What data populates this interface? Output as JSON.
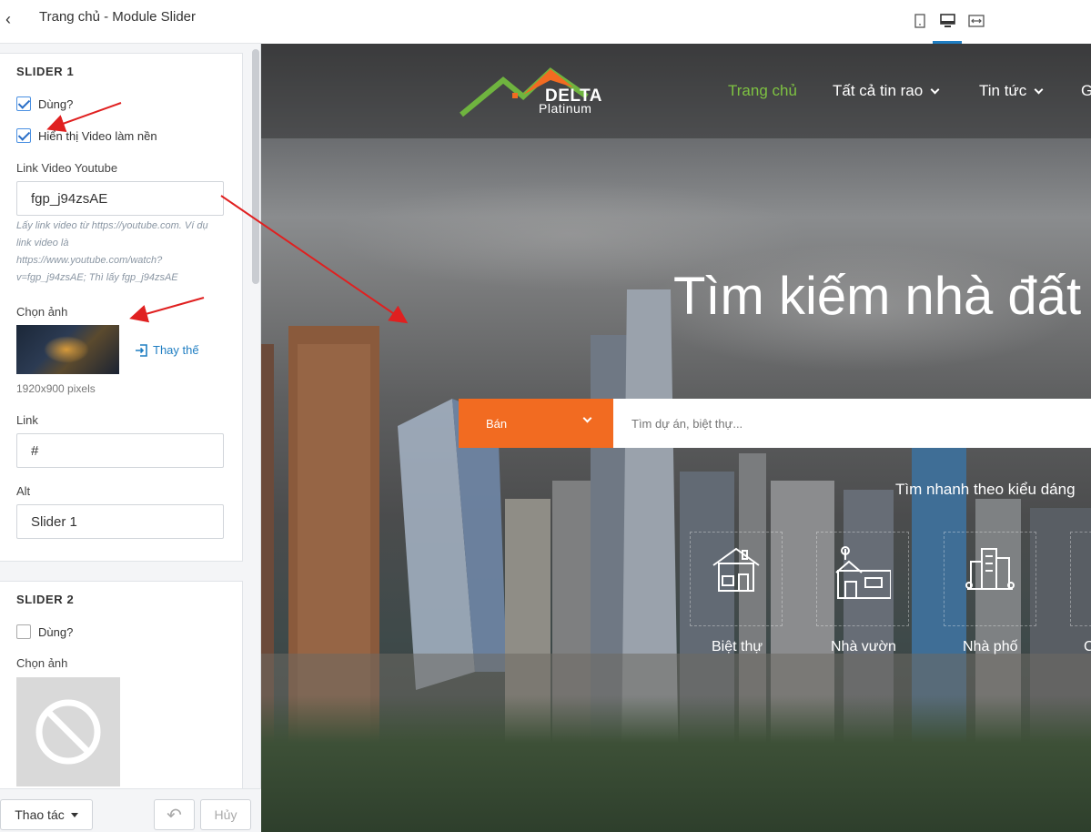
{
  "panel": {
    "title": "Trang chủ - Module Slider",
    "back_icon": "‹",
    "slider1": {
      "heading": "SLIDER 1",
      "use_label": "Dùng?",
      "use_checked": true,
      "video_bg_label": "Hiển thị Video làm nền",
      "video_bg_checked": true,
      "video_link_label": "Link Video Youtube",
      "video_link_value": "fgp_j94zsAE",
      "video_hint_1": "Lấy link video từ https://youtube.com. Ví dụ",
      "video_hint_2": "link video là",
      "video_hint_3": "https://www.youtube.com/watch?",
      "video_hint_4": "v=fgp_j94zsAE; Thì lấy fgp_j94zsAE",
      "image_label": "Chọn ảnh",
      "replace_label": "Thay thế",
      "image_size": "1920x900 pixels",
      "link_label": "Link",
      "link_value": "#",
      "alt_label": "Alt",
      "alt_value": "Slider 1"
    },
    "slider2": {
      "heading": "SLIDER 2",
      "use_label": "Dùng?",
      "use_checked": false,
      "image_label": "Chọn ảnh"
    },
    "footer": {
      "actions_label": "Thao tác",
      "undo_icon": "↶",
      "cancel_label": "Hủy"
    }
  },
  "toolbar": {
    "devices": [
      "mobile-icon",
      "desktop-icon",
      "fullwidth-icon"
    ],
    "active_device": "desktop-icon",
    "accent": "#1f7ec2"
  },
  "preview": {
    "logo_text_1": "DELTA",
    "logo_text_2": "Platinum",
    "nav": {
      "home": "Trang chủ",
      "all_listings": "Tất cả tin rao",
      "news": "Tin tức",
      "more": "G"
    },
    "hero_title": "Tìm kiếm nhà đất",
    "search": {
      "type_label": "Bán",
      "placeholder": "Tìm dự án, biệt thự..."
    },
    "quick_title": "Tìm nhanh theo kiểu dáng",
    "categories": [
      "Biệt thự",
      "Nhà vườn",
      "Nhà phố",
      "C"
    ],
    "colors": {
      "nav_active": "#7ec242",
      "search_type_bg": "#f26b21",
      "annotation_arrow": "#e02020"
    }
  }
}
